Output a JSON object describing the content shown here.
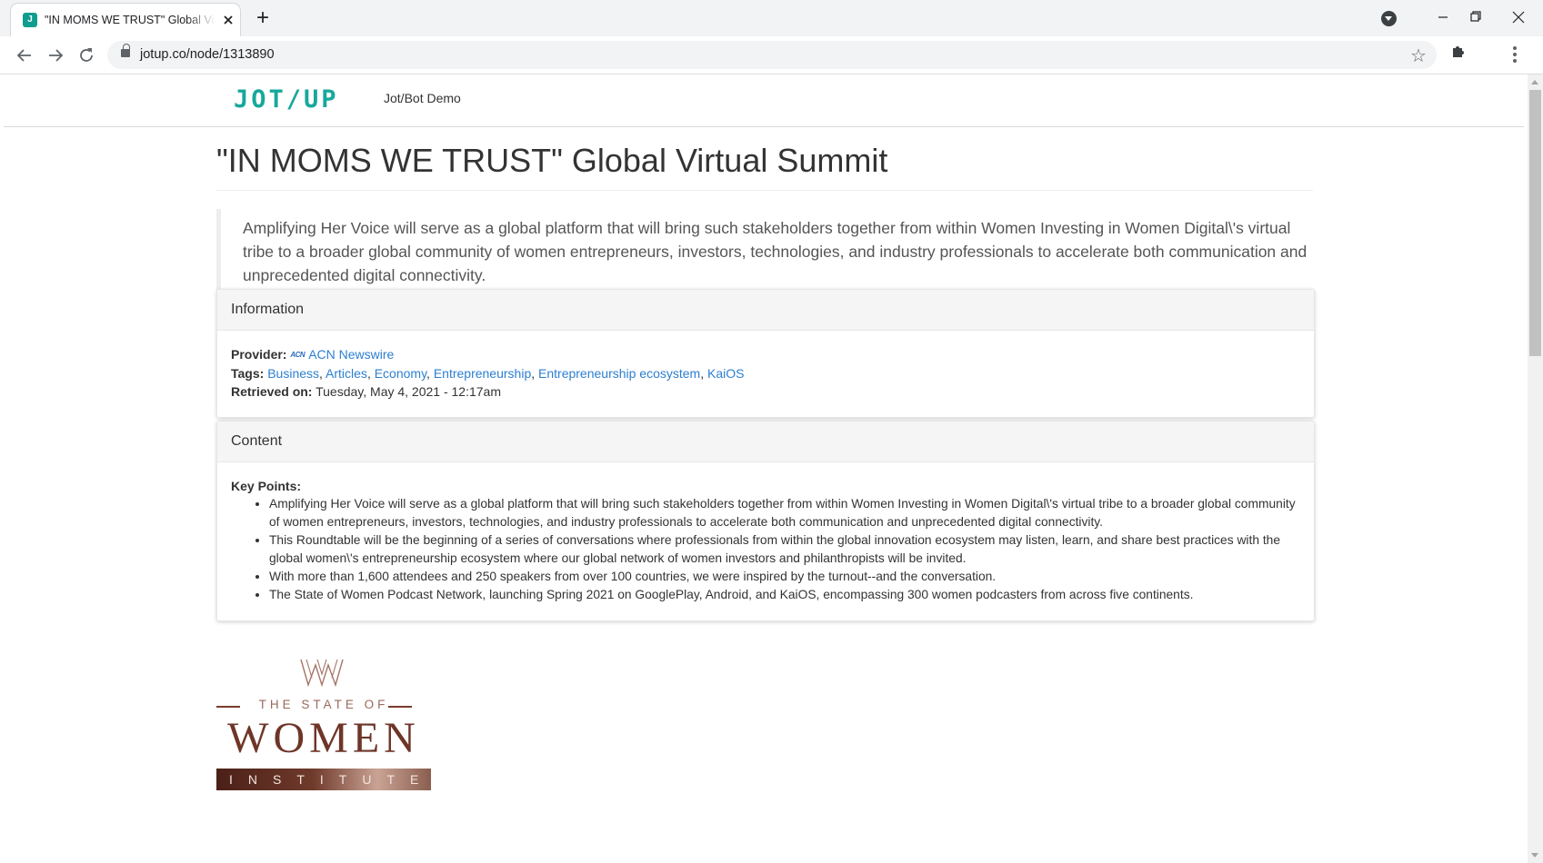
{
  "browser": {
    "tab_title": "\"IN MOMS WE TRUST\" Global Vir",
    "tab_favicon_letter": "J",
    "new_tab_glyph": "+",
    "url": "jotup.co/node/1313890",
    "icons": [
      "back-arrow-icon",
      "forward-arrow-icon",
      "reload-icon",
      "lock-icon",
      "star-icon",
      "extensions-puzzle-icon",
      "kebab-menu-icon",
      "profile-icon",
      "minimize-icon",
      "restore-icon",
      "close-icon"
    ],
    "favicon_color": "#0f9d8f"
  },
  "site": {
    "logo_text": "JOT/UP",
    "logo_color": "#17a89c",
    "nav_link": "Jot/Bot Demo",
    "link_color": "#2c7fd1"
  },
  "article": {
    "title": "\"IN MOMS WE TRUST\" Global Virtual Summit",
    "lead": "Amplifying Her Voice will serve as a global platform that will bring such stakeholders together from within Women Investing in Women Digital\\'s virtual tribe to a broader global community of women entrepreneurs, investors, technologies, and industry professionals to accelerate both communication and unprecedented digital connectivity."
  },
  "info_panel": {
    "heading": "Information",
    "provider_label": "Provider:",
    "provider_logo_text": "ACN",
    "provider_name": "ACN Newswire",
    "tags_label": "Tags:",
    "tags": [
      "Business",
      "Articles",
      "Economy",
      "Entrepreneurship",
      "Entrepreneurship ecosystem",
      "KaiOS"
    ],
    "retrieved_label": "Retrieved on:",
    "retrieved_value": "Tuesday, May 4, 2021 - 12:17am"
  },
  "content_panel": {
    "heading": "Content",
    "key_points_label": "Key Points:",
    "points": [
      "Amplifying Her Voice will serve as a global platform that will bring such stakeholders together from within Women Investing in Women Digital\\'s virtual tribe to a broader global community of women entrepreneurs, investors, technologies, and industry professionals to accelerate both communication and unprecedented digital connectivity.",
      "This Roundtable will be the beginning of a series of conversations where professionals from within the global innovation ecosystem may listen, learn, and share best practices with the global women\\'s entrepreneurship ecosystem where our global network of women investors and philanthropists will be invited.",
      "With more than 1,600 attendees and 250 speakers from over 100 countries, we were inspired by the turnout--and the conversation.",
      "The State of Women Podcast Network, launching Spring 2021 on GooglePlay, Android, and KaiOS, encompassing 300 women podcasters from across five continents."
    ]
  },
  "sow_logo": {
    "line1": "THE STATE OF",
    "line2": "WOMEN",
    "line3": "INSTITUTE",
    "brand_color": "#6e3528"
  }
}
